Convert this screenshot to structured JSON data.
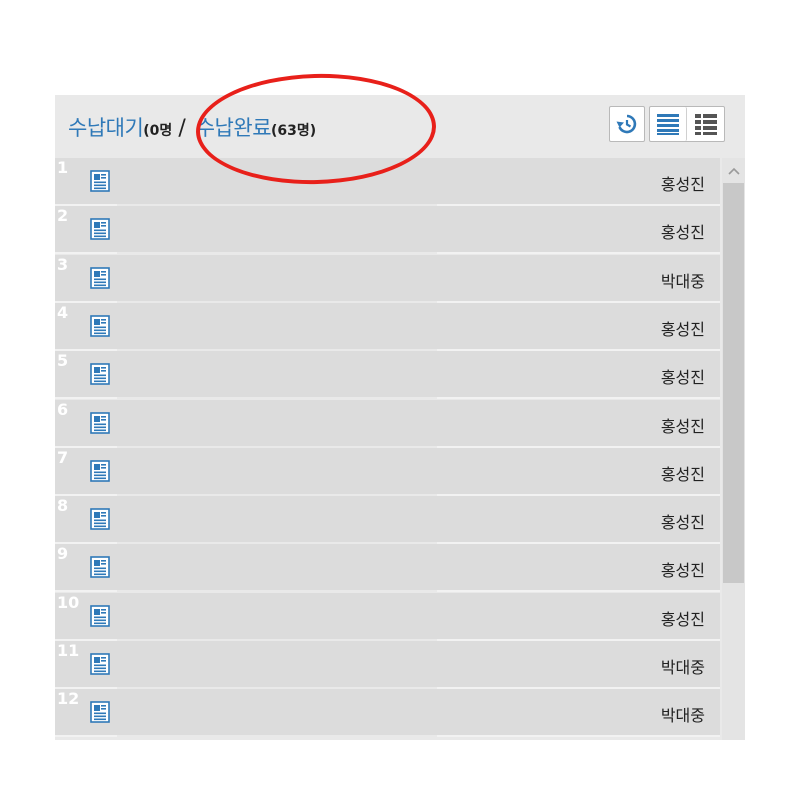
{
  "header": {
    "pending_label": "수납대기",
    "pending_count": "(0명",
    "separator": "/",
    "done_label": "수납완료",
    "done_count": "(63명)"
  },
  "toolbar": {
    "refresh_icon": "history-refresh-icon",
    "list_view_icon": "list-view-icon",
    "detail_view_icon": "detail-list-view-icon"
  },
  "rows": [
    {
      "num": "1",
      "name": "홍성진"
    },
    {
      "num": "2",
      "name": "홍성진"
    },
    {
      "num": "3",
      "name": "박대중"
    },
    {
      "num": "4",
      "name": "홍성진"
    },
    {
      "num": "5",
      "name": "홍성진"
    },
    {
      "num": "6",
      "name": "홍성진"
    },
    {
      "num": "7",
      "name": "홍성진"
    },
    {
      "num": "8",
      "name": "홍성진"
    },
    {
      "num": "9",
      "name": "홍성진"
    },
    {
      "num": "10",
      "name": "홍성진"
    },
    {
      "num": "11",
      "name": "박대중"
    },
    {
      "num": "12",
      "name": "박대중"
    }
  ],
  "colors": {
    "accent": "#2f79b8",
    "annotation": "#e8201a"
  }
}
